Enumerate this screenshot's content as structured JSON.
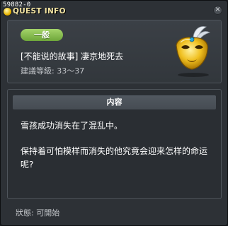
{
  "window": {
    "id_text": "59882-0",
    "title": "QUEST INFO"
  },
  "quest": {
    "category_badge": "一般",
    "name": "[不能说的故事] 凄京地死去",
    "level_text": "建議等級: 33～37",
    "icon": "golden-mask-icon"
  },
  "content": {
    "header": "内容",
    "paragraphs": [
      "雪孩成功消失在了混乱中。",
      "保持着可怕模样而消失的他究竟会迎来怎样的命运呢?"
    ]
  },
  "status": {
    "text": "狀態: 可開始"
  },
  "colors": {
    "badge_green": "#8cc150",
    "title_gold": "#f3e4a2",
    "panel_bg": "#2d3136"
  }
}
